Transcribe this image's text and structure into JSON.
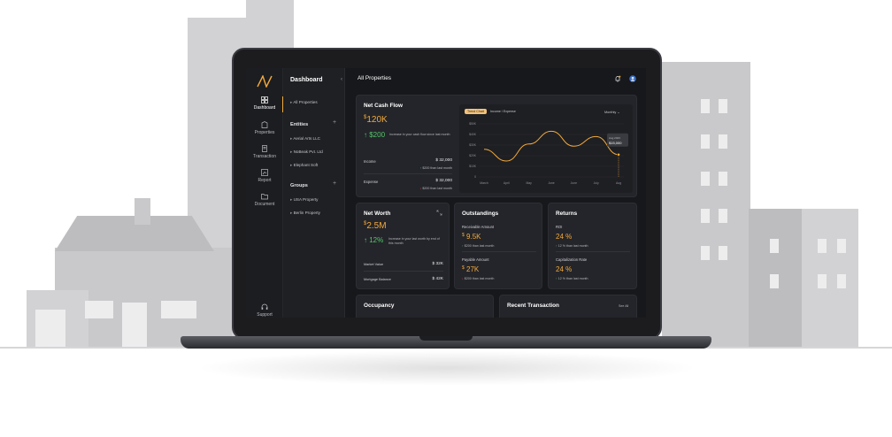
{
  "sidebar": {
    "items": [
      {
        "label": "Dashboard",
        "icon": "dashboard-icon",
        "active": true
      },
      {
        "label": "Properties",
        "icon": "building-icon",
        "active": false
      },
      {
        "label": "Transaction",
        "icon": "receipt-icon",
        "active": false
      },
      {
        "label": "Report",
        "icon": "report-icon",
        "active": false
      },
      {
        "label": "Document",
        "icon": "folder-icon",
        "active": false
      }
    ],
    "support": {
      "label": "Support",
      "icon": "headset-icon"
    }
  },
  "panel": {
    "title": "Dashboard",
    "all_properties": "All Properties",
    "entities_title": "Entities",
    "entities": [
      "Aerial Arts LLC",
      "NoBeak Pvt. Ltd",
      "Elephant Soft"
    ],
    "groups_title": "Groups",
    "groups": [
      "USA Property",
      "Berlin Property"
    ]
  },
  "header": {
    "title": "All Properties"
  },
  "net_cash_flow": {
    "title": "Net Cash Flow",
    "currency": "$",
    "value": "120K",
    "change": "$200",
    "change_text": "Increase in your cash flow since last month",
    "income_label": "Income",
    "income_value": "$ 32,000",
    "income_change": "$200 than last month",
    "expense_label": "Expense",
    "expense_value": "$ 32,000",
    "expense_change": "$200 than last month",
    "tabs": [
      "Trend Chart",
      "Income / Expense"
    ],
    "period": "Monthly"
  },
  "chart_data": {
    "type": "line",
    "categories": [
      "March",
      "April",
      "May",
      "June",
      "June",
      "July",
      "Aug"
    ],
    "values": [
      26,
      15,
      31,
      43,
      29,
      38,
      21
    ],
    "yticks": [
      "$50K",
      "$40K",
      "$30K",
      "$20K",
      "$10K",
      "0"
    ],
    "ylim": [
      0,
      50
    ],
    "tooltip_label": "Aug 2023",
    "tooltip_value": "$15,000",
    "colors": {
      "line": "#f3a93b"
    }
  },
  "net_worth": {
    "title": "Net Worth",
    "currency": "$",
    "value": "2.5M",
    "change": "12%",
    "change_text": "Increase in your last worth by end of this month",
    "market_label": "Market Value",
    "market_value": "$ 32K",
    "mortgage_label": "Mortgage Balance",
    "mortgage_value": "$ 42K"
  },
  "outstandings": {
    "title": "Outstandings",
    "receivable_label": "Receivable Amount",
    "receivable_currency": "$",
    "receivable_value": "9.5K",
    "receivable_change": "$200 than last month",
    "payable_label": "Payable Amount",
    "payable_currency": "$",
    "payable_value": "27K",
    "payable_change": "$200 than last month"
  },
  "returns": {
    "title": "Returns",
    "roi_label": "ROI",
    "roi_value": "24 %",
    "roi_change": "12 % than last month",
    "cap_label": "Capitalization Rate",
    "cap_value": "24 %",
    "cap_change": "12 % than last month"
  },
  "occupancy": {
    "title": "Occupancy"
  },
  "recent": {
    "title": "Recent Transaction",
    "see_all": "See All"
  },
  "colors": {
    "accent": "#f3a93b",
    "positive": "#54c76b",
    "negative": "#e05757",
    "background": "#17181b"
  }
}
